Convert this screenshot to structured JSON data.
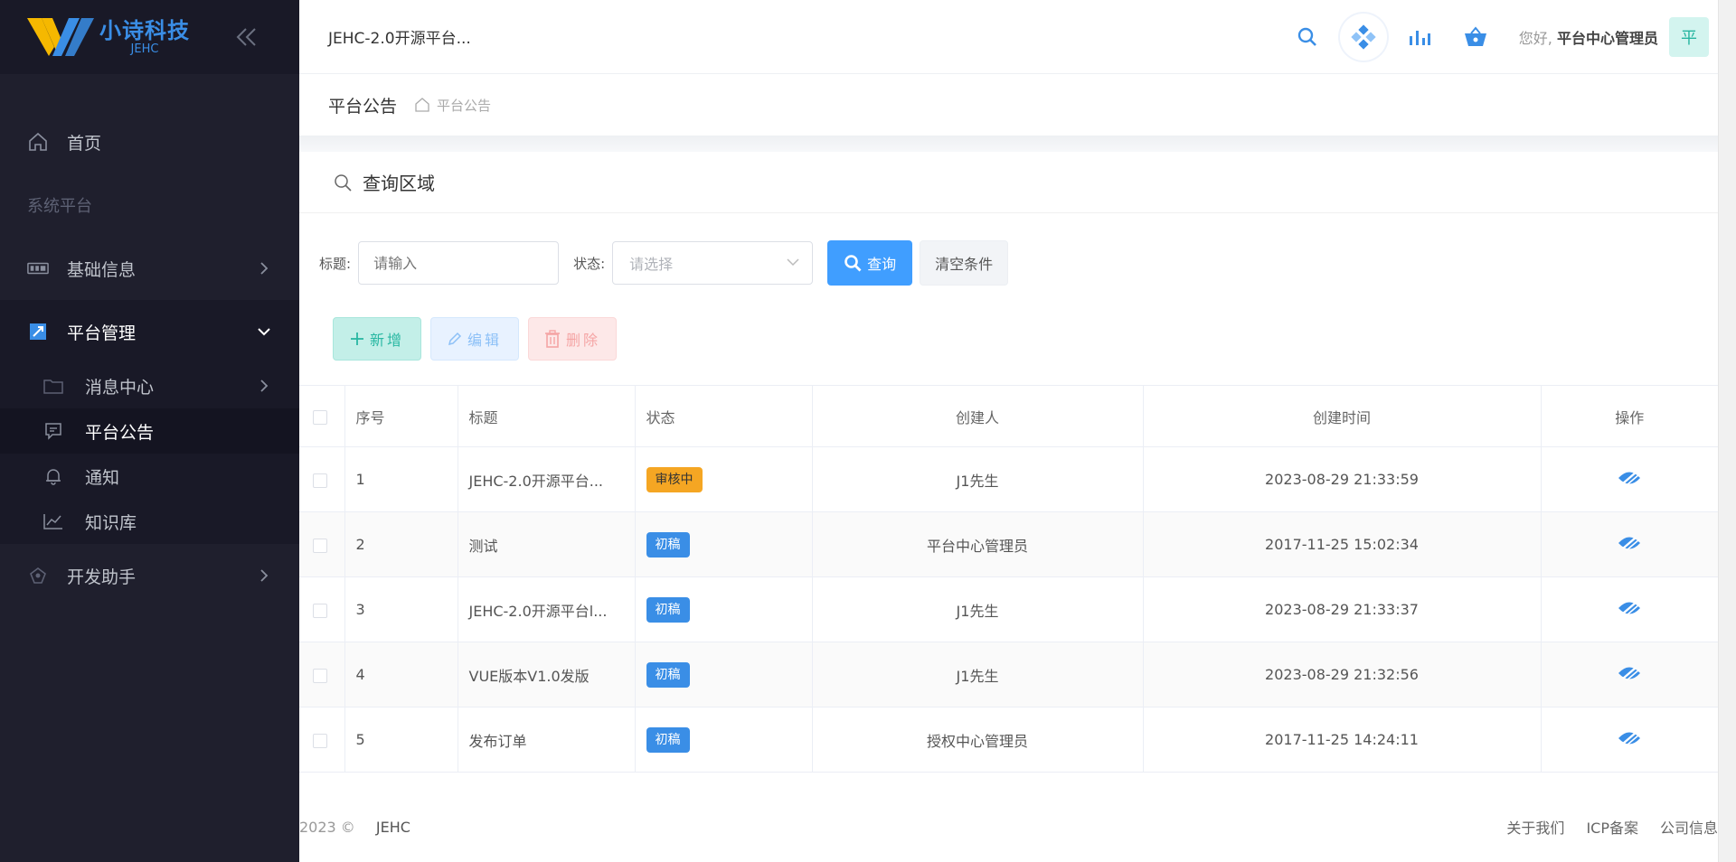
{
  "brand": {
    "name": "小诗科技",
    "sub": "JEHC",
    "colors": {
      "blue": "#3a8ee6",
      "yellow": "#f5b800"
    }
  },
  "sidebar": {
    "home": "首页",
    "group_title": "系统平台",
    "items": [
      {
        "label": "基础信息",
        "icon": "id-card-icon"
      },
      {
        "label": "平台管理",
        "icon": "platform-icon"
      },
      {
        "label": "开发助手",
        "icon": "helper-icon"
      }
    ],
    "submenu": [
      {
        "label": "消息中心",
        "icon": "folder-icon"
      },
      {
        "label": "平台公告",
        "icon": "chat-icon"
      },
      {
        "label": "通知",
        "icon": "bell-icon"
      },
      {
        "label": "知识库",
        "icon": "chart-line-icon"
      }
    ]
  },
  "topbar": {
    "title": "JEHC-2.0开源平台...",
    "greeting_prefix": "您好,",
    "user_name": "平台中心管理员",
    "avatar_text": "平"
  },
  "breadcrumb": {
    "page_title": "平台公告",
    "crumb": "平台公告"
  },
  "query": {
    "header": "查询区域",
    "title_label": "标题:",
    "title_placeholder": "请输入",
    "status_label": "状态:",
    "status_placeholder": "请选择",
    "search_button": "查询",
    "clear_button": "清空条件"
  },
  "actions": {
    "add": "新增",
    "edit": "编辑",
    "delete": "删除"
  },
  "table": {
    "columns": [
      "序号",
      "标题",
      "状态",
      "创建人",
      "创建时间",
      "操作"
    ],
    "rows": [
      {
        "no": "1",
        "title": "JEHC-2.0开源平台...",
        "status": "审核中",
        "status_type": "warn",
        "creator": "J1先生",
        "time": "2023-08-29 21:33:59"
      },
      {
        "no": "2",
        "title": "测试",
        "status": "初稿",
        "status_type": "info",
        "creator": "平台中心管理员",
        "time": "2017-11-25 15:02:34"
      },
      {
        "no": "3",
        "title": "JEHC-2.0开源平台l...",
        "status": "初稿",
        "status_type": "info",
        "creator": "J1先生",
        "time": "2023-08-29 21:33:37"
      },
      {
        "no": "4",
        "title": "VUE版本V1.0发版",
        "status": "初稿",
        "status_type": "info",
        "creator": "J1先生",
        "time": "2023-08-29 21:32:56"
      },
      {
        "no": "5",
        "title": "发布订单",
        "status": "初稿",
        "status_type": "info",
        "creator": "授权中心管理员",
        "time": "2017-11-25 14:24:11"
      }
    ]
  },
  "footer": {
    "copyright": "2023 ©",
    "brand": "JEHC",
    "links": [
      "关于我们",
      "ICP备案",
      "公司信息"
    ]
  }
}
